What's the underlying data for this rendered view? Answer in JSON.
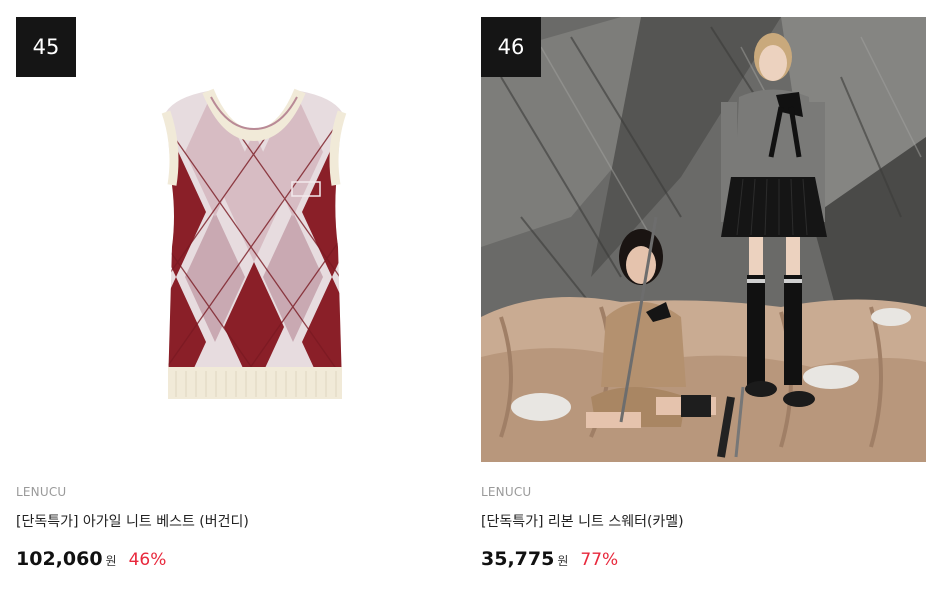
{
  "products": [
    {
      "rank": "45",
      "brand": "LENUCU",
      "title": "[단독특가] 아가일 니트 베스트 (버건디)",
      "price": "102,060",
      "currency": "원",
      "discount": "46%"
    },
    {
      "rank": "46",
      "brand": "LENUCU",
      "title": "[단독특가] 리본 니트 스웨터(카멜)",
      "price": "35,775",
      "currency": "원",
      "discount": "77%"
    }
  ],
  "colors": {
    "rank_bg": "#151515",
    "discount": "#e8283c",
    "brand": "#9a9a9a"
  }
}
